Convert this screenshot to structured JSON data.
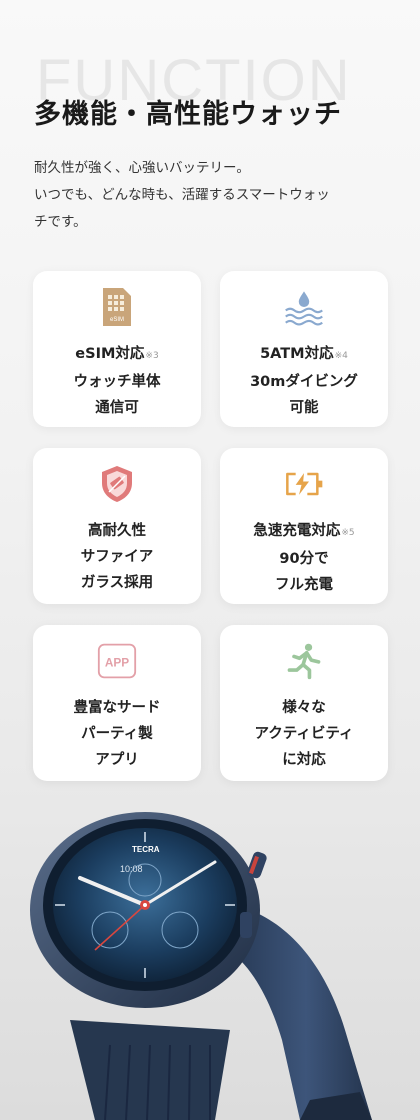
{
  "header": {
    "bg_word": "FUNCTION",
    "title": "多機能・高性能ウォッチ",
    "lead": [
      "耐久性が強く、心強いバッテリー。",
      "いつでも、どんな時も、活躍するスマートウォッ",
      "チです。"
    ]
  },
  "cards": [
    {
      "icon": "esim-icon",
      "lines": [
        "eSIM対応",
        "ウォッチ単体",
        "通信可"
      ],
      "note": "※3"
    },
    {
      "icon": "water-icon",
      "lines": [
        "5ATM対応",
        "30mダイビング",
        "可能"
      ],
      "note": "※4"
    },
    {
      "icon": "shield-icon",
      "lines": [
        "高耐久性",
        "サファイア",
        "ガラス採用"
      ],
      "note": ""
    },
    {
      "icon": "battery-icon",
      "lines": [
        "急速充電対応",
        "90分で",
        "フル充電"
      ],
      "note": "※5"
    },
    {
      "icon": "app-icon",
      "lines": [
        "豊富なサード",
        "パーティ製",
        "アプリ"
      ],
      "note": ""
    },
    {
      "icon": "running-icon",
      "lines": [
        "様々な",
        "アクティビティ",
        "に対応"
      ],
      "note": ""
    }
  ],
  "icon_labels": {
    "esim": "eSIM",
    "app": "APP"
  },
  "watch": {
    "brand": "TECRA",
    "time": "10:08"
  },
  "colors": {
    "accent": "#c9a57a",
    "water": "#8aa9cf",
    "danger": "#e07a7a",
    "app": "#e3a0a8",
    "running": "#9cc69c"
  }
}
